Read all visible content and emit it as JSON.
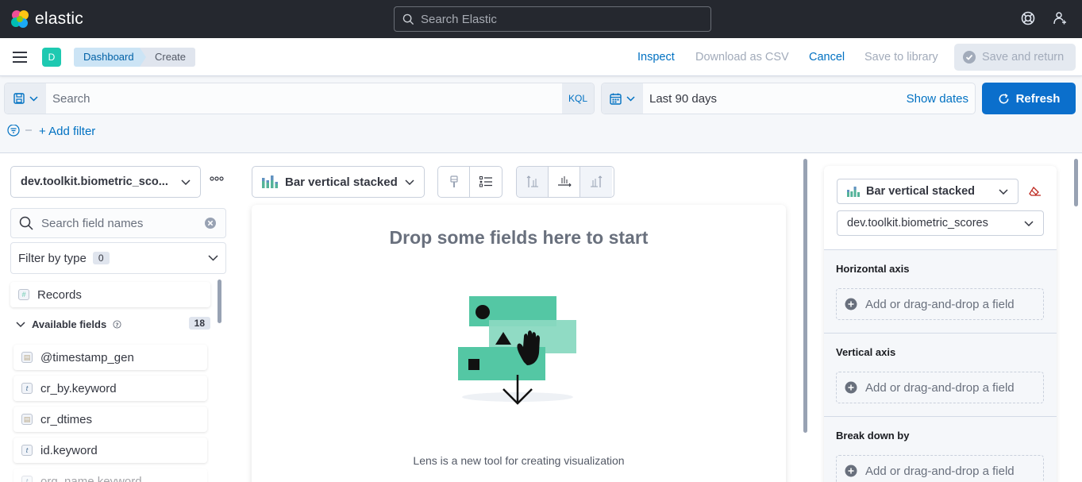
{
  "header": {
    "brand": "elastic",
    "search_placeholder": "Search Elastic"
  },
  "nav": {
    "space_initial": "D",
    "breadcrumbs": [
      "Dashboard",
      "Create"
    ],
    "actions": {
      "inspect": "Inspect",
      "download_csv": "Download as CSV",
      "cancel": "Cancel",
      "save_to_library": "Save to library",
      "save_and_return": "Save and return"
    }
  },
  "query_bar": {
    "placeholder": "Search",
    "language": "KQL",
    "date_range": "Last 90 days",
    "show_dates": "Show dates",
    "refresh": "Refresh",
    "add_filter": "+ Add filter"
  },
  "left_panel": {
    "index_pattern": "dev.toolkit.biometric_sco...",
    "field_search_placeholder": "Search field names",
    "filter_by_type": "Filter by type",
    "filter_count": "0",
    "records_label": "Records",
    "available_fields_label": "Available fields",
    "available_fields_count": "18",
    "fields": [
      {
        "name": "@timestamp_gen",
        "type": "date"
      },
      {
        "name": "cr_by.keyword",
        "type": "t"
      },
      {
        "name": "cr_dtimes",
        "type": "date"
      },
      {
        "name": "id.keyword",
        "type": "t"
      },
      {
        "name": "org_name.keyword",
        "type": "t"
      }
    ]
  },
  "workspace": {
    "chart_type": "Bar vertical stacked",
    "drop_title": "Drop some fields here to start",
    "drop_description": "Lens is a new tool for creating visualization"
  },
  "config_panel": {
    "chart_type": "Bar vertical stacked",
    "index_pattern": "dev.toolkit.biometric_scores",
    "sections": [
      {
        "label": "Horizontal axis",
        "slot": "Add or drag-and-drop a field"
      },
      {
        "label": "Vertical axis",
        "slot": "Add or drag-and-drop a field"
      },
      {
        "label": "Break down by",
        "slot": "Add or drag-and-drop a field"
      }
    ]
  },
  "colors": {
    "header_bg": "#25282f",
    "primary": "#0b6fcc",
    "link": "#0071c2",
    "space_avatar": "#1ec9b1",
    "illustration_green": "#54c7a4"
  }
}
